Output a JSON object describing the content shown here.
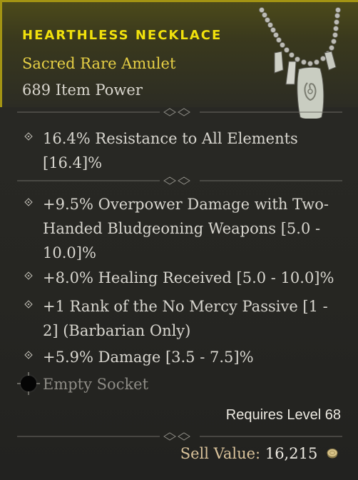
{
  "item": {
    "name": "HEARTHLESS NECKLACE",
    "type": "Sacred Rare Amulet",
    "power": "689 Item Power",
    "image_icon": "amulet-necklace-icon"
  },
  "implicit_affixes": [
    {
      "text": "16.4% Resistance to All Elements [16.4]%"
    }
  ],
  "affixes": [
    {
      "text": "+9.5% Overpower Damage with Two-Handed Bludgeoning Weapons [5.0 - 10.0]%"
    },
    {
      "text": "+8.0% Healing Received [5.0 - 10.0]%"
    },
    {
      "text": "+1 Rank of the No Mercy Passive [1 - 2] (Barbarian Only)"
    },
    {
      "text": "+5.9% Damage [3.5 - 7.5]%"
    }
  ],
  "socket": {
    "text": "Empty Socket",
    "icon": "empty-socket-icon"
  },
  "requirements": {
    "level_text": "Requires Level 68"
  },
  "sell": {
    "label": "Sell Value:",
    "value": "16,215",
    "icon": "gold-coin-icon"
  },
  "colors": {
    "title": "#f1e10c",
    "rarity": "#e6cf45",
    "border": "#a39413",
    "text": "#d8d6cf",
    "muted": "#8e8c86"
  }
}
